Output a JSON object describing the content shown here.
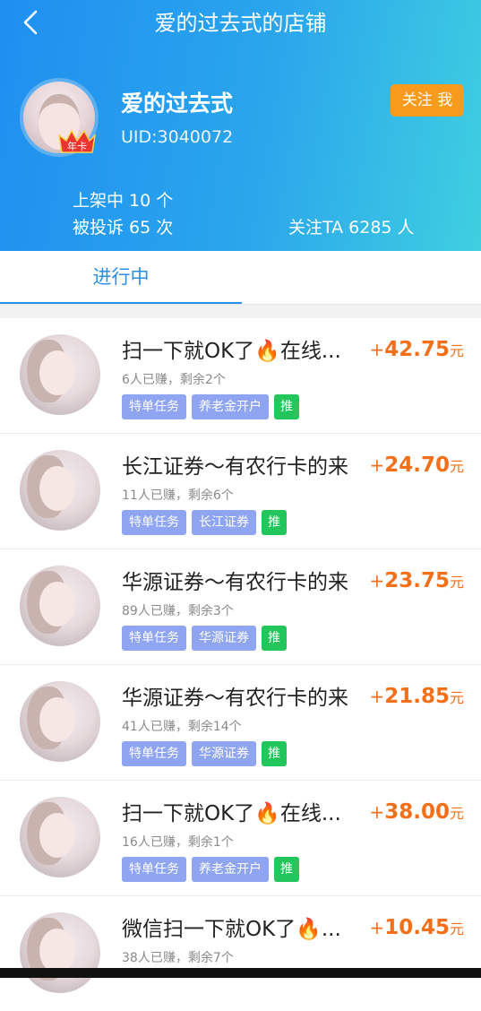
{
  "header": {
    "title": "爱的过去式的店铺",
    "shop_name": "爱的过去式",
    "uid": "UID:3040072",
    "badge": "年卡",
    "follow_label": "关注 我",
    "on_shelf": "上架中 10 个",
    "complaints": "被投诉 65 次",
    "followers": "关注TA 6285 人"
  },
  "tabs": [
    {
      "label": "进行中",
      "active": true
    }
  ],
  "colors": {
    "accent": "#2a8fe6",
    "price": "#f36f1a",
    "follow": "#f89a1b",
    "tag": "#8fa5f2",
    "push_tag": "#23c65a"
  },
  "tasks": [
    {
      "name": "扫一下就OK了🔥在线...",
      "meta": "6人已赚，剩余2个",
      "tags": [
        "特单任务",
        "养老金开户",
        "推"
      ],
      "price_prefix": "+",
      "price": "42.75",
      "unit": "元"
    },
    {
      "name": "长江证券～有农行卡的来",
      "meta": "11人已赚，剩余6个",
      "tags": [
        "特单任务",
        "长江证券",
        "推"
      ],
      "price_prefix": "+",
      "price": "24.70",
      "unit": "元"
    },
    {
      "name": "华源证券～有农行卡的来",
      "meta": "89人已赚，剩余3个",
      "tags": [
        "特单任务",
        "华源证券",
        "推"
      ],
      "price_prefix": "+",
      "price": "23.75",
      "unit": "元"
    },
    {
      "name": "华源证券～有农行卡的来",
      "meta": "41人已赚，剩余14个",
      "tags": [
        "特单任务",
        "华源证券",
        "推"
      ],
      "price_prefix": "+",
      "price": "21.85",
      "unit": "元"
    },
    {
      "name": "扫一下就OK了🔥在线...",
      "meta": "16人已赚，剩余1个",
      "tags": [
        "特单任务",
        "养老金开户",
        "推"
      ],
      "price_prefix": "+",
      "price": "38.00",
      "unit": "元"
    },
    {
      "name": "微信扫一下就OK了🔥...",
      "meta": "38人已赚，剩余7个",
      "tags": [],
      "price_prefix": "+",
      "price": "10.45",
      "unit": "元"
    }
  ]
}
